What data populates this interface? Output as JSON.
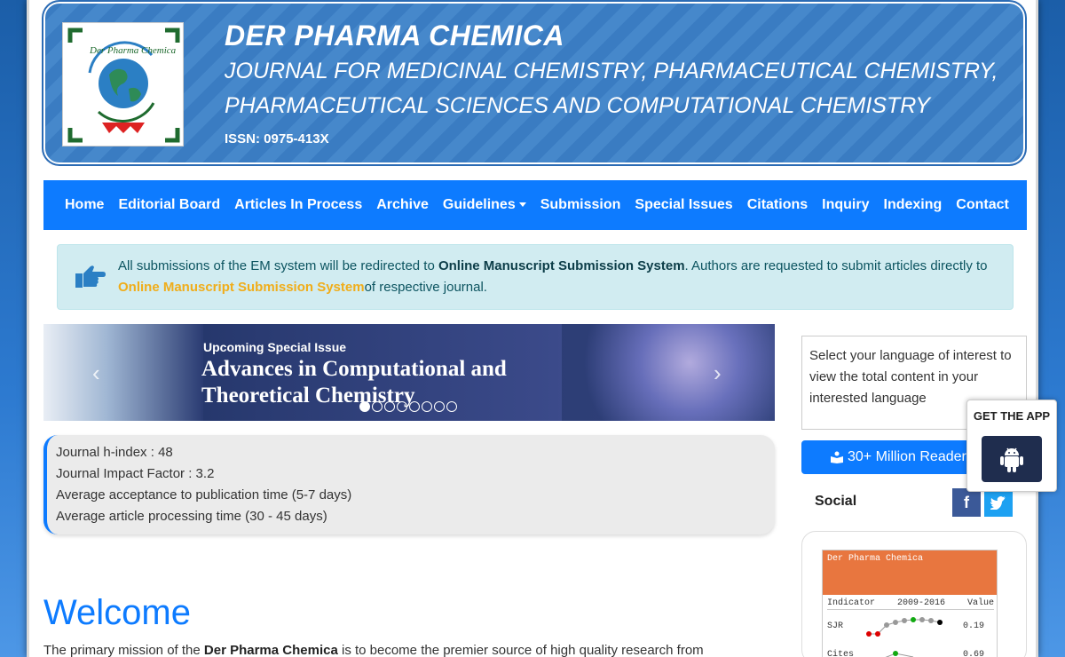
{
  "header": {
    "title": "DER PHARMA CHEMICA",
    "subtitle_line1": "JOURNAL FOR MEDICINAL CHEMISTRY, PHARMACEUTICAL CHEMISTRY,",
    "subtitle_line2": "PHARMACEUTICAL SCIENCES AND COMPUTATIONAL CHEMISTRY",
    "issn": "ISSN: 0975-413X",
    "logo_text": "Der Pharma Chemica"
  },
  "nav": {
    "items": [
      "Home",
      "Editorial Board",
      "Articles In Process",
      "Archive",
      "Guidelines",
      "Submission",
      "Special Issues",
      "Citations",
      "Inquiry",
      "Indexing",
      "Contact"
    ]
  },
  "alert": {
    "text_before": "All submissions of the EM system will be redirected to ",
    "bold_link": "Online Manuscript Submission System",
    "text_middle": ". Authors are requested to submit articles directly to ",
    "link": "Online Manuscript Submission System",
    "text_after": "of respective journal."
  },
  "carousel": {
    "kicker": "Upcoming Special Issue",
    "heading_line1": "Advances in Computational and",
    "heading_line2": "Theoretical Chemistry",
    "prev": "‹",
    "next": "›",
    "slide_count": 8,
    "active_slide": 0
  },
  "metrics": {
    "h_index": "Journal h-index : 48",
    "impact_factor": "Journal Impact Factor : 3.2",
    "acceptance_time": "Average acceptance to publication time (5-7 days)",
    "processing_time": "Average article processing time (30 - 45 days)"
  },
  "welcome": {
    "title": "Welcome",
    "text_before": "The primary mission of the ",
    "bold": "Der Pharma Chemica",
    "text_after": " is to become the premier source of high quality research from"
  },
  "sidebar": {
    "language_text": "Select your language of interest to view the total content in your interested language",
    "readers_button": "30+ Million Readers",
    "social_label": "Social",
    "facebook_glyph": "f",
    "twitter_glyph": "t"
  },
  "sjr": {
    "title": "Der Pharma Chemica",
    "col_indicator": "Indicator",
    "col_years": "2009-2016",
    "col_value": "Value",
    "row1_label": "SJR",
    "row1_value": "0.19",
    "row2_label": "Cites",
    "row2_value": "0.69"
  },
  "app": {
    "label": "GET THE APP"
  },
  "colors": {
    "nav_blue": "#0d7bff",
    "alert_bg": "#d1ecf1",
    "link_gold": "#f0ad1a",
    "sjr_orange": "#e8763f"
  }
}
